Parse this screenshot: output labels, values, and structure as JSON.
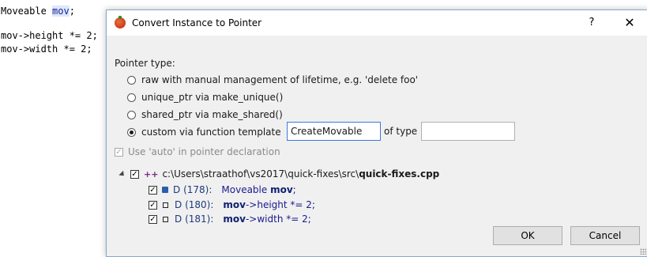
{
  "editor": {
    "line1_type": "Moveable",
    "line1_var": "mov",
    "line1_end": ";",
    "line3": "mov->height *= 2;",
    "line4": "mov->width *= 2;"
  },
  "dialog": {
    "title": "Convert Instance to Pointer",
    "help_label": "?",
    "close_label": "✕",
    "pointer_type_label": "Pointer type:",
    "options": [
      {
        "label": "raw with manual management of lifetime, e.g. 'delete foo'",
        "selected": false
      },
      {
        "label": "unique_ptr via make_unique()",
        "selected": false
      },
      {
        "label": "shared_ptr via make_shared()",
        "selected": false
      },
      {
        "label": "custom via function template",
        "selected": true
      }
    ],
    "function_template_value": "CreateMovable",
    "of_type_label": "of type",
    "type_value": "",
    "use_auto_label": "Use 'auto' in pointer declaration",
    "use_auto_checked": true,
    "file": {
      "path_prefix": "c:\\Users\\straathof\\vs2017\\quick-fixes\\src\\",
      "file_name": "quick-fixes.cpp"
    },
    "references": [
      {
        "kind": "D",
        "line": "(178):",
        "code_pre": "Moveable ",
        "code_bold": "mov",
        "code_post": ";"
      },
      {
        "kind": "D",
        "line": "(180):",
        "code_pre": "",
        "code_bold": "mov",
        "code_post": "->height *= 2;"
      },
      {
        "kind": "D",
        "line": "(181):",
        "code_pre": "",
        "code_bold": "mov",
        "code_post": "->width *= 2;"
      }
    ],
    "ok_label": "OK",
    "cancel_label": "Cancel"
  }
}
